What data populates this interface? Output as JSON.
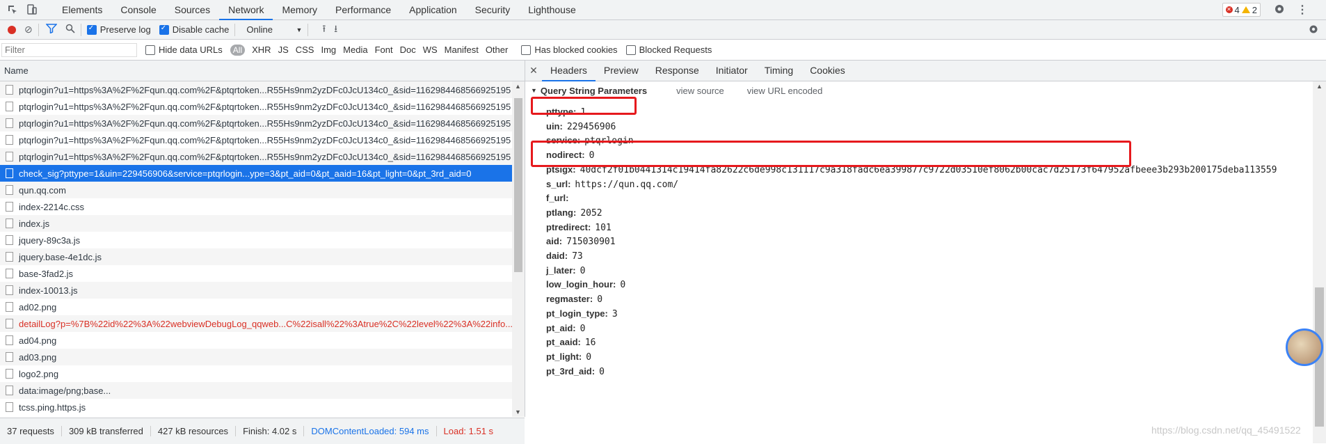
{
  "tabs": [
    "Elements",
    "Console",
    "Sources",
    "Network",
    "Memory",
    "Performance",
    "Application",
    "Security",
    "Lighthouse"
  ],
  "active_tab": "Network",
  "issues": {
    "errors": "4",
    "warnings": "2"
  },
  "toolbar": {
    "preserve_log": "Preserve log",
    "disable_cache": "Disable cache",
    "throttle": "Online"
  },
  "filter": {
    "placeholder": "Filter",
    "hide_data_urls": "Hide data URLs",
    "types": [
      "All",
      "XHR",
      "JS",
      "CSS",
      "Img",
      "Media",
      "Font",
      "Doc",
      "WS",
      "Manifest",
      "Other"
    ],
    "has_blocked_cookies": "Has blocked cookies",
    "blocked_requests": "Blocked Requests"
  },
  "requests_header": "Name",
  "requests": [
    {
      "name": "ptqrlogin?u1=https%3A%2F%2Fqun.qq.com%2F&ptqrtoken...R55Hs9nm2yzDFc0JcU134c0_&sid=1162984468566925195"
    },
    {
      "name": "ptqrlogin?u1=https%3A%2F%2Fqun.qq.com%2F&ptqrtoken...R55Hs9nm2yzDFc0JcU134c0_&sid=1162984468566925195"
    },
    {
      "name": "ptqrlogin?u1=https%3A%2F%2Fqun.qq.com%2F&ptqrtoken...R55Hs9nm2yzDFc0JcU134c0_&sid=1162984468566925195"
    },
    {
      "name": "ptqrlogin?u1=https%3A%2F%2Fqun.qq.com%2F&ptqrtoken...R55Hs9nm2yzDFc0JcU134c0_&sid=1162984468566925195"
    },
    {
      "name": "ptqrlogin?u1=https%3A%2F%2Fqun.qq.com%2F&ptqrtoken...R55Hs9nm2yzDFc0JcU134c0_&sid=1162984468566925195"
    },
    {
      "name": "check_sig?pttype=1&uin=229456906&service=ptqrlogin...ype=3&pt_aid=0&pt_aaid=16&pt_light=0&pt_3rd_aid=0"
    },
    {
      "name": "qun.qq.com"
    },
    {
      "name": "index-2214c.css"
    },
    {
      "name": "index.js"
    },
    {
      "name": "jquery-89c3a.js"
    },
    {
      "name": "jquery.base-4e1dc.js"
    },
    {
      "name": "base-3fad2.js"
    },
    {
      "name": "index-10013.js"
    },
    {
      "name": "ad02.png"
    },
    {
      "name": "detailLog?p=%7B%22id%22%3A%22webviewDebugLog_qqweb...C%22isall%22%3Atrue%2C%22level%22%3A%22info..."
    },
    {
      "name": "ad04.png"
    },
    {
      "name": "ad03.png"
    },
    {
      "name": "logo2.png"
    },
    {
      "name": "data:image/png;base..."
    },
    {
      "name": "tcss.ping.https.js"
    }
  ],
  "selected_index": 5,
  "red_index": 14,
  "status": {
    "requests": "37 requests",
    "transferred": "309 kB transferred",
    "resources": "427 kB resources",
    "finish": "Finish: 4.02 s",
    "dcl": "DOMContentLoaded: 594 ms",
    "load": "Load: 1.51 s"
  },
  "detail_tabs": [
    "Headers",
    "Preview",
    "Response",
    "Initiator",
    "Timing",
    "Cookies"
  ],
  "active_detail_tab": "Headers",
  "query_section": {
    "title": "Query String Parameters",
    "view_source": "view source",
    "view_url_encoded": "view URL encoded"
  },
  "params": [
    {
      "k": "pttype:",
      "v": "1"
    },
    {
      "k": "uin:",
      "v": "229456906"
    },
    {
      "k": "service:",
      "v": "ptqrlogin"
    },
    {
      "k": "nodirect:",
      "v": "0"
    },
    {
      "k": "ptsigx:",
      "v": "40dcf2f01b0441314c19414fa82622c6de998c131117c9a318fadc6ea399877c9722d03510ef8062b00cac7d25173f647952afbeee3b293b200175deba113559"
    },
    {
      "k": "s_url:",
      "v": "https://qun.qq.com/"
    },
    {
      "k": "f_url:",
      "v": ""
    },
    {
      "k": "ptlang:",
      "v": "2052"
    },
    {
      "k": "ptredirect:",
      "v": "101"
    },
    {
      "k": "aid:",
      "v": "715030901"
    },
    {
      "k": "daid:",
      "v": "73"
    },
    {
      "k": "j_later:",
      "v": "0"
    },
    {
      "k": "low_login_hour:",
      "v": "0"
    },
    {
      "k": "regmaster:",
      "v": "0"
    },
    {
      "k": "pt_login_type:",
      "v": "3"
    },
    {
      "k": "pt_aid:",
      "v": "0"
    },
    {
      "k": "pt_aaid:",
      "v": "16"
    },
    {
      "k": "pt_light:",
      "v": "0"
    },
    {
      "k": "pt_3rd_aid:",
      "v": "0"
    }
  ],
  "watermark": "https://blog.csdn.net/qq_45491522"
}
